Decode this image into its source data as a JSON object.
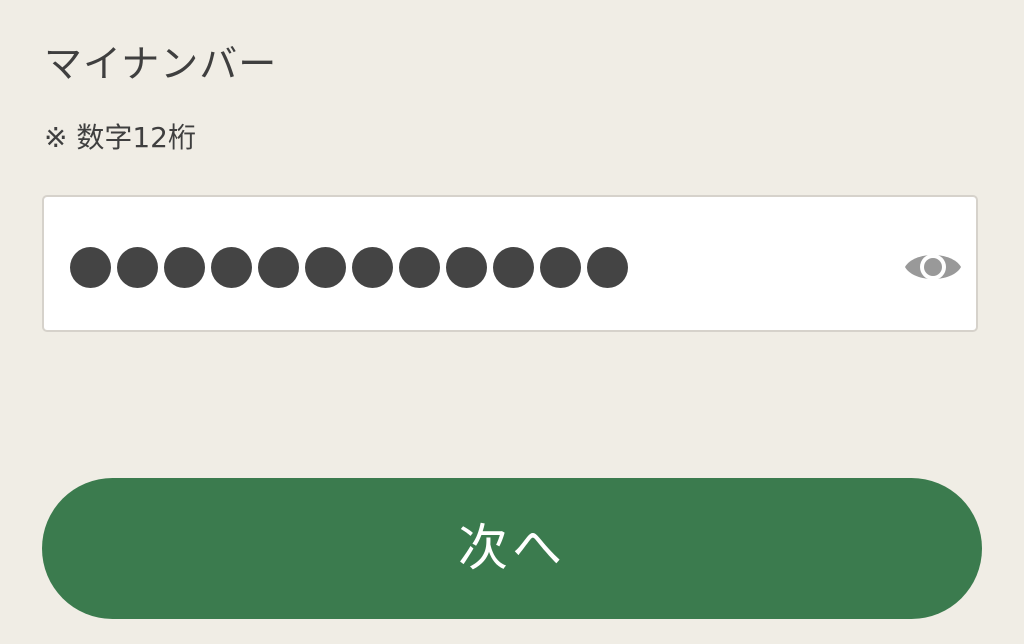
{
  "field": {
    "title": "マイナンバー",
    "note": "※ 数字12桁",
    "masked_length": 12,
    "reveal_icon": "eye-icon"
  },
  "button": {
    "label": "次へ"
  },
  "colors": {
    "background": "#f0ede5",
    "button": "#3b7b4e",
    "text": "#3f3f3f",
    "dot": "#444444",
    "icon": "#999999"
  }
}
